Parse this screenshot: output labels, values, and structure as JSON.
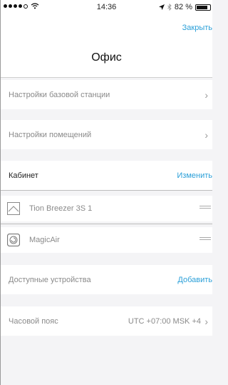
{
  "status_bar": {
    "time": "14:36",
    "battery": "82 %",
    "battery_level": 0.82
  },
  "header": {
    "close_label": "Закрыть",
    "title": "Офис"
  },
  "settings": {
    "base_station": "Настройки базовой станции",
    "rooms": "Настройки помещений"
  },
  "room": {
    "name": "Кабинет",
    "edit_label": "Изменить",
    "devices": [
      {
        "label": "Tion Breezer 3S 1",
        "icon": "breezer-icon"
      },
      {
        "label": "MagicAir",
        "icon": "magicair-icon"
      }
    ]
  },
  "available": {
    "label": "Доступные устройства",
    "add_label": "Добавить"
  },
  "timezone": {
    "label": "Часовой пояс",
    "value": "UTC +07:00 MSK +4"
  }
}
